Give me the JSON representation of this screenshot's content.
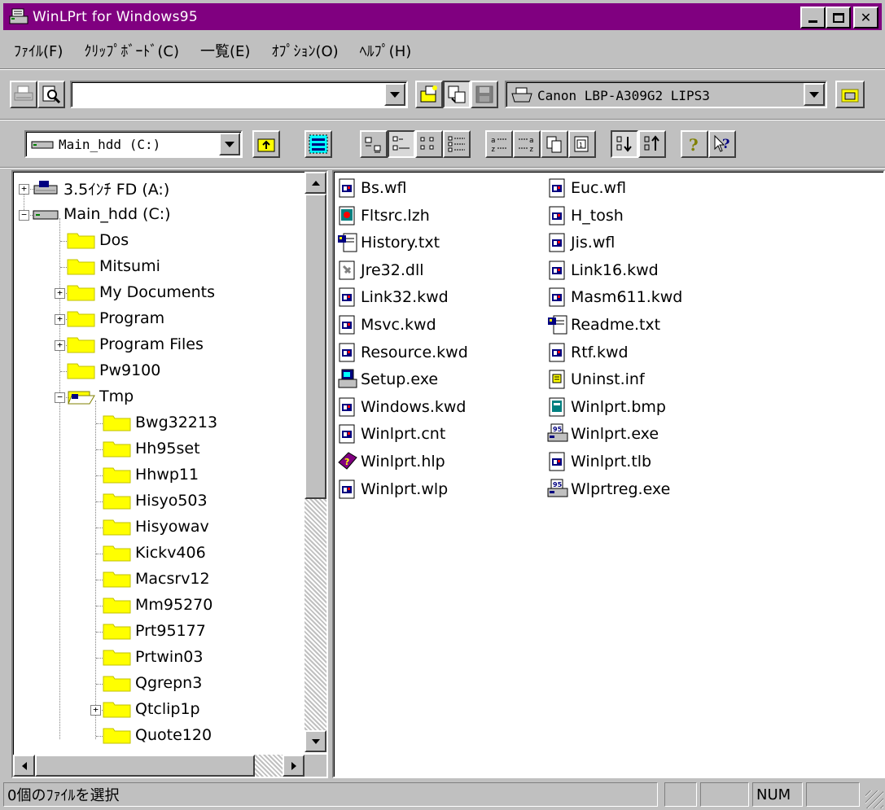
{
  "window": {
    "title": "WinLPrt for Windows95",
    "title_bar_color": "#800080",
    "controls": {
      "minimize": "_",
      "maximize": "□",
      "close": "✕"
    }
  },
  "menu": {
    "items": [
      "ﾌｧｲﾙ(F)",
      "ｸﾘｯﾌﾟﾎﾞｰﾄﾞ(C)",
      "一覧(E)",
      "ｵﾌﾟｼｮﾝ(O)",
      "ﾍﾙﾌﾟ(H)"
    ]
  },
  "toolbar1": {
    "path_value": "",
    "printer_value": "Canon LBP-A309G2 LIPS3",
    "icons": [
      "print-icon",
      "preview-icon",
      "open-file-icon",
      "clipboard-icon",
      "save-icon",
      "printer-icon",
      "folder-open-icon"
    ]
  },
  "toolbar2": {
    "drive_value": "Main_hdd (C:)",
    "icons": [
      "up-folder-icon",
      "select-all-icon",
      "large-icons-view-icon",
      "small-icons-view-icon",
      "list-view-icon",
      "details-view-icon",
      "sort-name-icon",
      "sort-ext-icon",
      "sort-size-icon",
      "sort-date-icon",
      "sort-ascending-icon",
      "sort-descending-icon",
      "help-icon",
      "context-help-icon"
    ]
  },
  "tree": {
    "items": [
      {
        "label": "3.5ｲﾝﾁ FD (A:)",
        "level": 0,
        "expander": "+",
        "type": "floppy"
      },
      {
        "label": "Main_hdd (C:)",
        "level": 0,
        "expander": "-",
        "type": "drive"
      },
      {
        "label": "Dos",
        "level": 1,
        "expander": "",
        "type": "folder"
      },
      {
        "label": "Mitsumi",
        "level": 1,
        "expander": "",
        "type": "folder"
      },
      {
        "label": "My Documents",
        "level": 1,
        "expander": "+",
        "type": "folder"
      },
      {
        "label": "Program",
        "level": 1,
        "expander": "+",
        "type": "folder"
      },
      {
        "label": "Program Files",
        "level": 1,
        "expander": "+",
        "type": "folder"
      },
      {
        "label": "Pw9100",
        "level": 1,
        "expander": "",
        "type": "folder"
      },
      {
        "label": "Tmp",
        "level": 1,
        "expander": "-",
        "type": "folder-open"
      },
      {
        "label": "Bwg32213",
        "level": 2,
        "expander": "",
        "type": "folder"
      },
      {
        "label": "Hh95set",
        "level": 2,
        "expander": "",
        "type": "folder"
      },
      {
        "label": "Hhwp11",
        "level": 2,
        "expander": "",
        "type": "folder"
      },
      {
        "label": "Hisyo503",
        "level": 2,
        "expander": "",
        "type": "folder"
      },
      {
        "label": "Hisyowav",
        "level": 2,
        "expander": "",
        "type": "folder"
      },
      {
        "label": "Kickv406",
        "level": 2,
        "expander": "",
        "type": "folder"
      },
      {
        "label": "Macsrv12",
        "level": 2,
        "expander": "",
        "type": "folder"
      },
      {
        "label": "Mm95270",
        "level": 2,
        "expander": "",
        "type": "folder"
      },
      {
        "label": "Prt95177",
        "level": 2,
        "expander": "",
        "type": "folder"
      },
      {
        "label": "Prtwin03",
        "level": 2,
        "expander": "",
        "type": "folder"
      },
      {
        "label": "Qgrepn3",
        "level": 2,
        "expander": "",
        "type": "folder"
      },
      {
        "label": "Qtclip1p",
        "level": 2,
        "expander": "+",
        "type": "folder"
      },
      {
        "label": "Quote120",
        "level": 2,
        "expander": "",
        "type": "folder"
      }
    ]
  },
  "files": {
    "col1": [
      {
        "name": "Bs.wfl",
        "icon": "wfl-icon"
      },
      {
        "name": "Fltsrc.lzh",
        "icon": "archive-icon"
      },
      {
        "name": "History.txt",
        "icon": "text-doc-icon"
      },
      {
        "name": "Jre32.dll",
        "icon": "dll-icon"
      },
      {
        "name": "Link32.kwd",
        "icon": "kwd-icon"
      },
      {
        "name": "Msvc.kwd",
        "icon": "kwd-icon"
      },
      {
        "name": "Resource.kwd",
        "icon": "kwd-icon"
      },
      {
        "name": "Setup.exe",
        "icon": "setup-icon"
      },
      {
        "name": "Windows.kwd",
        "icon": "kwd-icon"
      },
      {
        "name": "Winlprt.cnt",
        "icon": "cnt-icon"
      },
      {
        "name": "Winlprt.hlp",
        "icon": "help-file-icon"
      },
      {
        "name": "Winlprt.wlp",
        "icon": "wlp-icon"
      }
    ],
    "col2": [
      {
        "name": "Euc.wfl",
        "icon": "wfl-icon"
      },
      {
        "name": "H_tosh",
        "icon": "generic-file-icon"
      },
      {
        "name": "Jis.wfl",
        "icon": "wfl-icon"
      },
      {
        "name": "Link16.kwd",
        "icon": "kwd-icon"
      },
      {
        "name": "Masm611.kwd",
        "icon": "kwd-icon"
      },
      {
        "name": "Readme.txt",
        "icon": "text-doc-icon"
      },
      {
        "name": "Rtf.kwd",
        "icon": "kwd-icon"
      },
      {
        "name": "Uninst.inf",
        "icon": "inf-icon"
      },
      {
        "name": "Winlprt.bmp",
        "icon": "bitmap-icon"
      },
      {
        "name": "Winlprt.exe",
        "icon": "printer-app-icon"
      },
      {
        "name": "Winlprt.tlb",
        "icon": "tlb-icon"
      },
      {
        "name": "Wlprtreg.exe",
        "icon": "printer-app-icon"
      }
    ]
  },
  "status": {
    "message": "0個のﾌｧｲﾙを選択",
    "panel2": "",
    "panel3": "",
    "num": "NUM",
    "panel5": ""
  }
}
